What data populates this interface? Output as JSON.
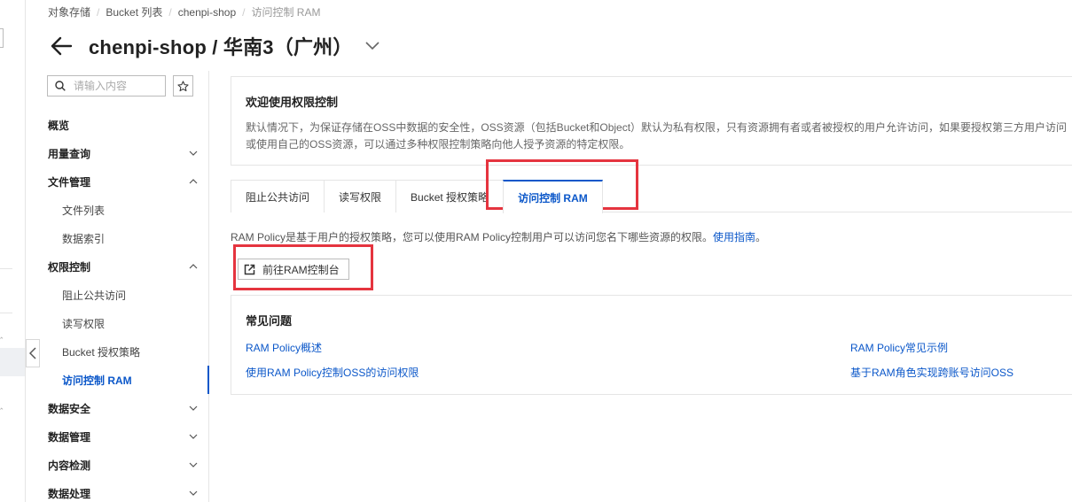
{
  "breadcrumb": [
    "对象存储",
    "Bucket 列表",
    "chenpi-shop",
    "访问控制 RAM"
  ],
  "header": {
    "title": "chenpi-shop / 华南3（广州）"
  },
  "sidebar": {
    "search_placeholder": "请输入内容",
    "items": [
      {
        "label": "概览"
      },
      {
        "label": "用量查询"
      },
      {
        "label": "文件管理"
      },
      {
        "label": "文件列表"
      },
      {
        "label": "数据索引"
      },
      {
        "label": "权限控制"
      },
      {
        "label": "阻止公共访问"
      },
      {
        "label": "读写权限"
      },
      {
        "label": "Bucket 授权策略"
      },
      {
        "label": "访问控制 RAM"
      },
      {
        "label": "数据安全"
      },
      {
        "label": "数据管理"
      },
      {
        "label": "内容检测"
      },
      {
        "label": "数据处理"
      }
    ]
  },
  "welcome": {
    "title": "欢迎使用权限控制",
    "text": "默认情况下，为保证存储在OSS中数据的安全性，OSS资源（包括Bucket和Object）默认为私有权限，只有资源拥有者或者被授权的用户允许访问，如果要授权第三方用户访问或使用自己的OSS资源，可以通过多种权限控制策略向他人授予资源的特定权限。"
  },
  "tabs": [
    {
      "label": "阻止公共访问"
    },
    {
      "label": "读写权限"
    },
    {
      "label": "Bucket 授权策略"
    },
    {
      "label": "访问控制 RAM"
    }
  ],
  "ram": {
    "description": "RAM Policy是基于用户的授权策略，您可以使用RAM Policy控制用户可以访问您名下哪些资源的权限。",
    "guide_link": "使用指南",
    "guide_suffix": "。",
    "button_label": "前往RAM控制台"
  },
  "faq": {
    "title": "常见问题",
    "links": [
      "RAM Policy概述",
      "使用RAM Policy控制OSS的访问权限",
      "RAM Policy常见示例",
      "基于RAM角色实现跨账号访问OSS"
    ]
  },
  "colors": {
    "accent": "#0b57c9",
    "highlight": "#e5343f"
  }
}
